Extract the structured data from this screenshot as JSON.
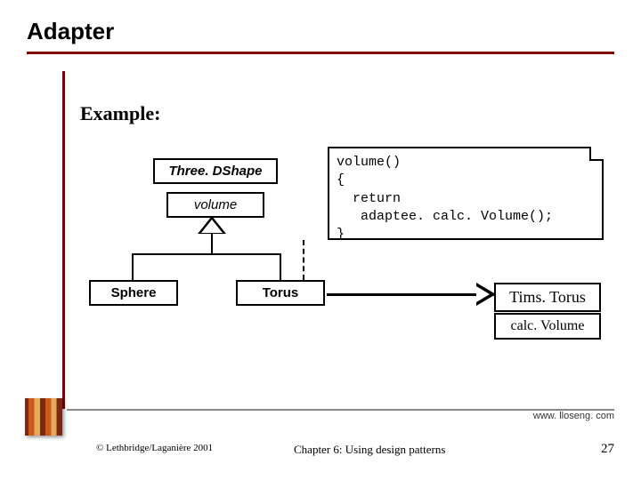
{
  "slide": {
    "title": "Adapter",
    "example_label": "Example:"
  },
  "uml": {
    "abstract_class": "Three. DShape",
    "abstract_op": "volume",
    "sphere": "Sphere",
    "torus": "Torus",
    "adaptee_class": "Tims. Torus",
    "adaptee_op": "calc. Volume",
    "note_code": "volume()\n{\n  return\n   adaptee. calc. Volume();\n}"
  },
  "footer": {
    "url": "www. lloseng. com",
    "copyright": "© Lethbridge/Laganière 2001",
    "chapter": "Chapter 6: Using design patterns",
    "page": "27"
  }
}
